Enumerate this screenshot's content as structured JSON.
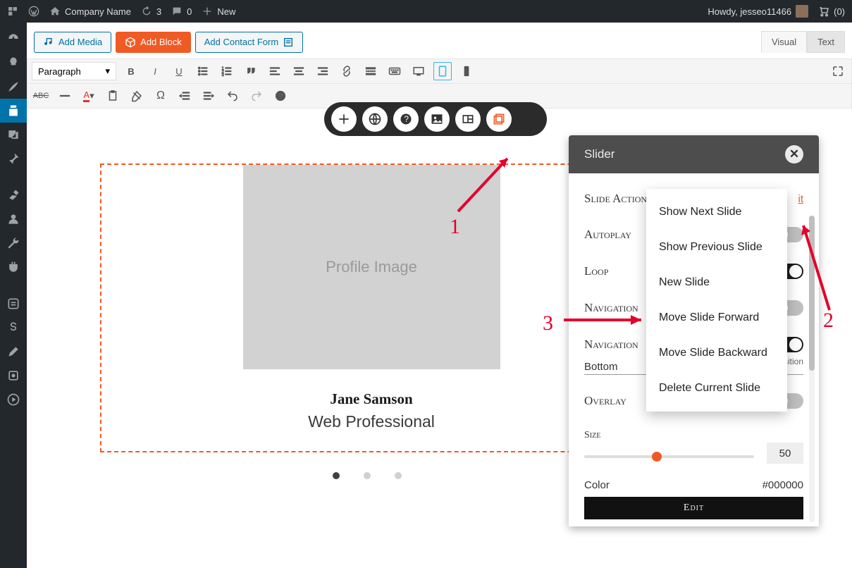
{
  "topbar": {
    "site_name": "Company Name",
    "updates_count": "3",
    "comments_count": "0",
    "new_label": "New",
    "howdy": "Howdy, jesseo11466",
    "cart_count": "(0)"
  },
  "buttons": {
    "add_media": "Add Media",
    "add_block": "Add Block",
    "add_contact": "Add Contact Form"
  },
  "tabs": {
    "visual": "Visual",
    "text": "Text"
  },
  "format_select": "Paragraph",
  "slide": {
    "image_placeholder": "Profile Image",
    "name": "Jane Samson",
    "role": "Web Professional"
  },
  "panel": {
    "title": "Slider",
    "slide_action_label": "Slide Action",
    "edit_link": "it",
    "autoplay_label": "Autoplay",
    "loop_label": "Loop",
    "navigation_label": "Navigation",
    "navigation2_label": "Navigation",
    "position_label": "Position",
    "position_value": "Bottom",
    "overlay_label": "Overlay",
    "size_label": "Size",
    "size_value": "50",
    "color_label": "Color",
    "color_value": "#000000",
    "edit_btn": "Edit"
  },
  "dropdown": {
    "items": [
      "Show Next Slide",
      "Show Previous Slide",
      "New Slide",
      "Move Slide Forward",
      "Move Slide Backward",
      "Delete Current Slide"
    ]
  },
  "annotations": {
    "a1": "1",
    "a2": "2",
    "a3": "3"
  }
}
